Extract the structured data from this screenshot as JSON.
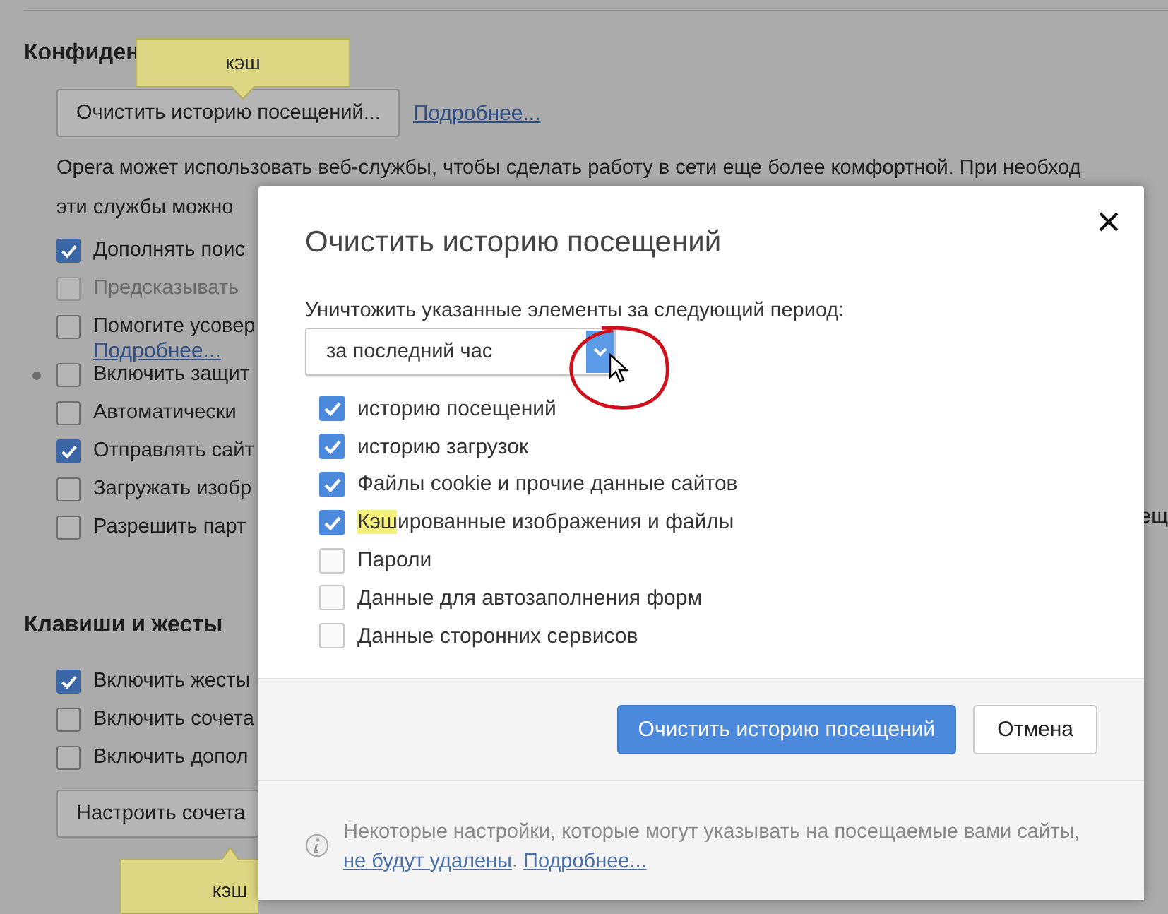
{
  "settings_page": {
    "privacy_section": {
      "heading": "Конфиден",
      "clear_button": "Очистить историю посещений...",
      "more_link": "Подробнее...",
      "description_lines": [
        "Opera может использовать веб-службы, чтобы сделать работу в сети еще более комфортной. При необход",
        "эти службы можно"
      ],
      "options": [
        {
          "label": "Дополнять поис",
          "checked": true,
          "disabled": false,
          "bullet": false
        },
        {
          "label": "Предсказывать",
          "checked": false,
          "disabled": true,
          "bullet": false
        },
        {
          "label": "Помогите усовер",
          "checked": false,
          "disabled": false,
          "bullet": false,
          "link": "Подробнее..."
        },
        {
          "label": "Включить защит",
          "checked": false,
          "disabled": false,
          "bullet": true
        },
        {
          "label": "Автоматически",
          "checked": false,
          "disabled": false,
          "bullet": false
        },
        {
          "label": "Отправлять сайт",
          "checked": true,
          "disabled": false,
          "bullet": false
        },
        {
          "label": "Загружать изобр",
          "checked": false,
          "disabled": false,
          "bullet": false
        },
        {
          "label": "Разрешить парт",
          "checked": false,
          "disabled": false,
          "bullet": false
        }
      ],
      "side_fragment": "ещ"
    },
    "keys_section": {
      "heading": "Клавиши и жесты",
      "options": [
        {
          "label": "Включить жесты",
          "checked": true
        },
        {
          "label": "Включить сочета",
          "checked": false
        },
        {
          "label": "Включить допол",
          "checked": false
        }
      ],
      "button": "Настроить сочета"
    }
  },
  "callouts": [
    {
      "text": "кэш"
    },
    {
      "text": "кэш"
    }
  ],
  "dialog": {
    "title": "Очистить историю посещений",
    "period_label": "Уничтожить указанные элементы за следующий период:",
    "period_value": "за последний час",
    "items": [
      {
        "label": "историю посещений",
        "checked": true
      },
      {
        "label": "историю загрузок",
        "checked": true
      },
      {
        "label": "Файлы cookie и прочие данные сайтов",
        "checked": true
      },
      {
        "highlight": "Кэш",
        "label": "ированные изображения и файлы",
        "checked": true
      },
      {
        "label": "Пароли",
        "checked": false
      },
      {
        "label": "Данные для автозаполнения форм",
        "checked": false
      },
      {
        "label": "Данные сторонних сервисов",
        "checked": false
      }
    ],
    "primary_button": "Очистить историю посещений",
    "cancel_button": "Отмена",
    "note": {
      "text": "Некоторые настройки, которые могут указывать на посещаемые вами сайты, ",
      "link": "не будут удалены",
      "after": ".",
      "more_link": "Подробнее..."
    }
  }
}
